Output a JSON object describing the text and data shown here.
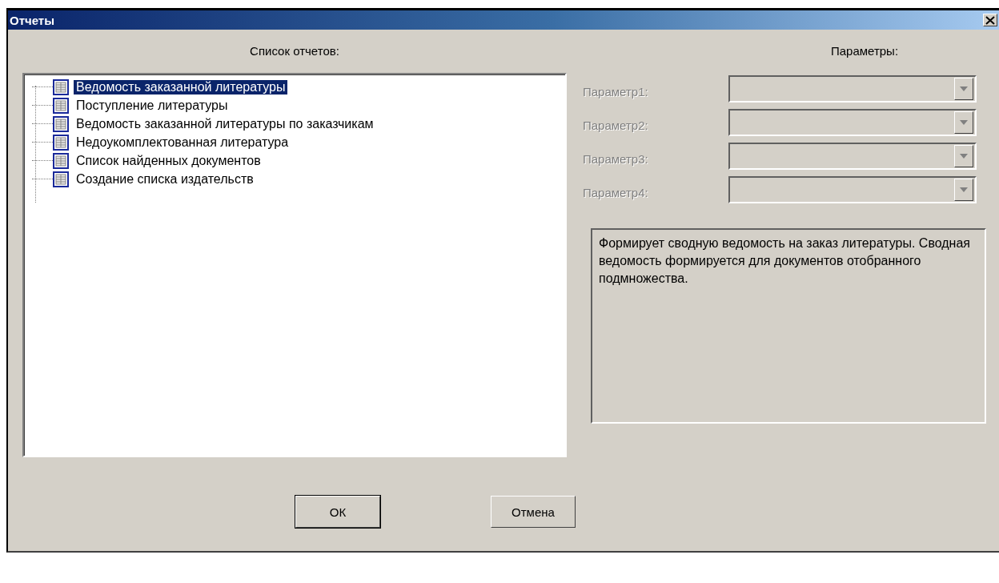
{
  "window": {
    "title": "Отчеты"
  },
  "reports": {
    "heading": "Список отчетов:",
    "items": [
      {
        "label": "Ведомость заказанной литературы",
        "selected": true
      },
      {
        "label": "Поступление литературы",
        "selected": false
      },
      {
        "label": "Ведомость заказанной литературы по заказчикам",
        "selected": false
      },
      {
        "label": "Недоукомплектованная литература",
        "selected": false
      },
      {
        "label": "Список найденных документов",
        "selected": false
      },
      {
        "label": "Создание списка издательств",
        "selected": false
      }
    ]
  },
  "parameters": {
    "heading": "Параметры:",
    "items": [
      {
        "label": "Параметр1:",
        "disabled": true
      },
      {
        "label": "Параметр2:",
        "disabled": true
      },
      {
        "label": "Параметр3:",
        "disabled": true
      },
      {
        "label": "Параметр4:",
        "disabled": true
      }
    ],
    "description": "Формирует сводную ведомость на заказ литературы. Сводная ведомость формируется для документов отобранного подмножества."
  },
  "buttons": [
    {
      "label": "ОК",
      "kind": "default"
    },
    {
      "label": "Отмена",
      "kind": "normal"
    }
  ]
}
